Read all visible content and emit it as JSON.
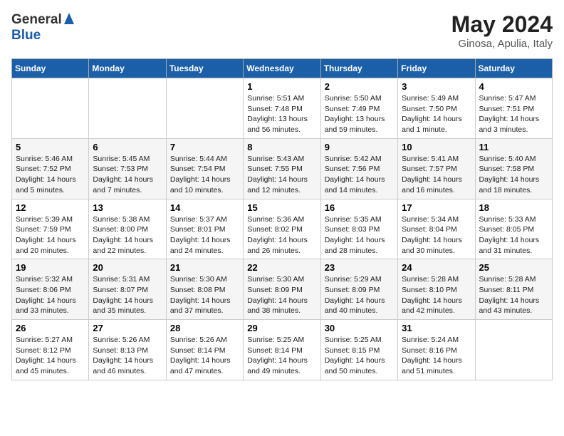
{
  "header": {
    "logo_general": "General",
    "logo_blue": "Blue",
    "title": "May 2024",
    "location": "Ginosa, Apulia, Italy"
  },
  "days_of_week": [
    "Sunday",
    "Monday",
    "Tuesday",
    "Wednesday",
    "Thursday",
    "Friday",
    "Saturday"
  ],
  "weeks": [
    [
      {
        "day": null,
        "info": null
      },
      {
        "day": null,
        "info": null
      },
      {
        "day": null,
        "info": null
      },
      {
        "day": "1",
        "info": "Sunrise: 5:51 AM\nSunset: 7:48 PM\nDaylight: 13 hours and 56 minutes."
      },
      {
        "day": "2",
        "info": "Sunrise: 5:50 AM\nSunset: 7:49 PM\nDaylight: 13 hours and 59 minutes."
      },
      {
        "day": "3",
        "info": "Sunrise: 5:49 AM\nSunset: 7:50 PM\nDaylight: 14 hours and 1 minute."
      },
      {
        "day": "4",
        "info": "Sunrise: 5:47 AM\nSunset: 7:51 PM\nDaylight: 14 hours and 3 minutes."
      }
    ],
    [
      {
        "day": "5",
        "info": "Sunrise: 5:46 AM\nSunset: 7:52 PM\nDaylight: 14 hours and 5 minutes."
      },
      {
        "day": "6",
        "info": "Sunrise: 5:45 AM\nSunset: 7:53 PM\nDaylight: 14 hours and 7 minutes."
      },
      {
        "day": "7",
        "info": "Sunrise: 5:44 AM\nSunset: 7:54 PM\nDaylight: 14 hours and 10 minutes."
      },
      {
        "day": "8",
        "info": "Sunrise: 5:43 AM\nSunset: 7:55 PM\nDaylight: 14 hours and 12 minutes."
      },
      {
        "day": "9",
        "info": "Sunrise: 5:42 AM\nSunset: 7:56 PM\nDaylight: 14 hours and 14 minutes."
      },
      {
        "day": "10",
        "info": "Sunrise: 5:41 AM\nSunset: 7:57 PM\nDaylight: 14 hours and 16 minutes."
      },
      {
        "day": "11",
        "info": "Sunrise: 5:40 AM\nSunset: 7:58 PM\nDaylight: 14 hours and 18 minutes."
      }
    ],
    [
      {
        "day": "12",
        "info": "Sunrise: 5:39 AM\nSunset: 7:59 PM\nDaylight: 14 hours and 20 minutes."
      },
      {
        "day": "13",
        "info": "Sunrise: 5:38 AM\nSunset: 8:00 PM\nDaylight: 14 hours and 22 minutes."
      },
      {
        "day": "14",
        "info": "Sunrise: 5:37 AM\nSunset: 8:01 PM\nDaylight: 14 hours and 24 minutes."
      },
      {
        "day": "15",
        "info": "Sunrise: 5:36 AM\nSunset: 8:02 PM\nDaylight: 14 hours and 26 minutes."
      },
      {
        "day": "16",
        "info": "Sunrise: 5:35 AM\nSunset: 8:03 PM\nDaylight: 14 hours and 28 minutes."
      },
      {
        "day": "17",
        "info": "Sunrise: 5:34 AM\nSunset: 8:04 PM\nDaylight: 14 hours and 30 minutes."
      },
      {
        "day": "18",
        "info": "Sunrise: 5:33 AM\nSunset: 8:05 PM\nDaylight: 14 hours and 31 minutes."
      }
    ],
    [
      {
        "day": "19",
        "info": "Sunrise: 5:32 AM\nSunset: 8:06 PM\nDaylight: 14 hours and 33 minutes."
      },
      {
        "day": "20",
        "info": "Sunrise: 5:31 AM\nSunset: 8:07 PM\nDaylight: 14 hours and 35 minutes."
      },
      {
        "day": "21",
        "info": "Sunrise: 5:30 AM\nSunset: 8:08 PM\nDaylight: 14 hours and 37 minutes."
      },
      {
        "day": "22",
        "info": "Sunrise: 5:30 AM\nSunset: 8:09 PM\nDaylight: 14 hours and 38 minutes."
      },
      {
        "day": "23",
        "info": "Sunrise: 5:29 AM\nSunset: 8:09 PM\nDaylight: 14 hours and 40 minutes."
      },
      {
        "day": "24",
        "info": "Sunrise: 5:28 AM\nSunset: 8:10 PM\nDaylight: 14 hours and 42 minutes."
      },
      {
        "day": "25",
        "info": "Sunrise: 5:28 AM\nSunset: 8:11 PM\nDaylight: 14 hours and 43 minutes."
      }
    ],
    [
      {
        "day": "26",
        "info": "Sunrise: 5:27 AM\nSunset: 8:12 PM\nDaylight: 14 hours and 45 minutes."
      },
      {
        "day": "27",
        "info": "Sunrise: 5:26 AM\nSunset: 8:13 PM\nDaylight: 14 hours and 46 minutes."
      },
      {
        "day": "28",
        "info": "Sunrise: 5:26 AM\nSunset: 8:14 PM\nDaylight: 14 hours and 47 minutes."
      },
      {
        "day": "29",
        "info": "Sunrise: 5:25 AM\nSunset: 8:14 PM\nDaylight: 14 hours and 49 minutes."
      },
      {
        "day": "30",
        "info": "Sunrise: 5:25 AM\nSunset: 8:15 PM\nDaylight: 14 hours and 50 minutes."
      },
      {
        "day": "31",
        "info": "Sunrise: 5:24 AM\nSunset: 8:16 PM\nDaylight: 14 hours and 51 minutes."
      },
      {
        "day": null,
        "info": null
      }
    ]
  ]
}
